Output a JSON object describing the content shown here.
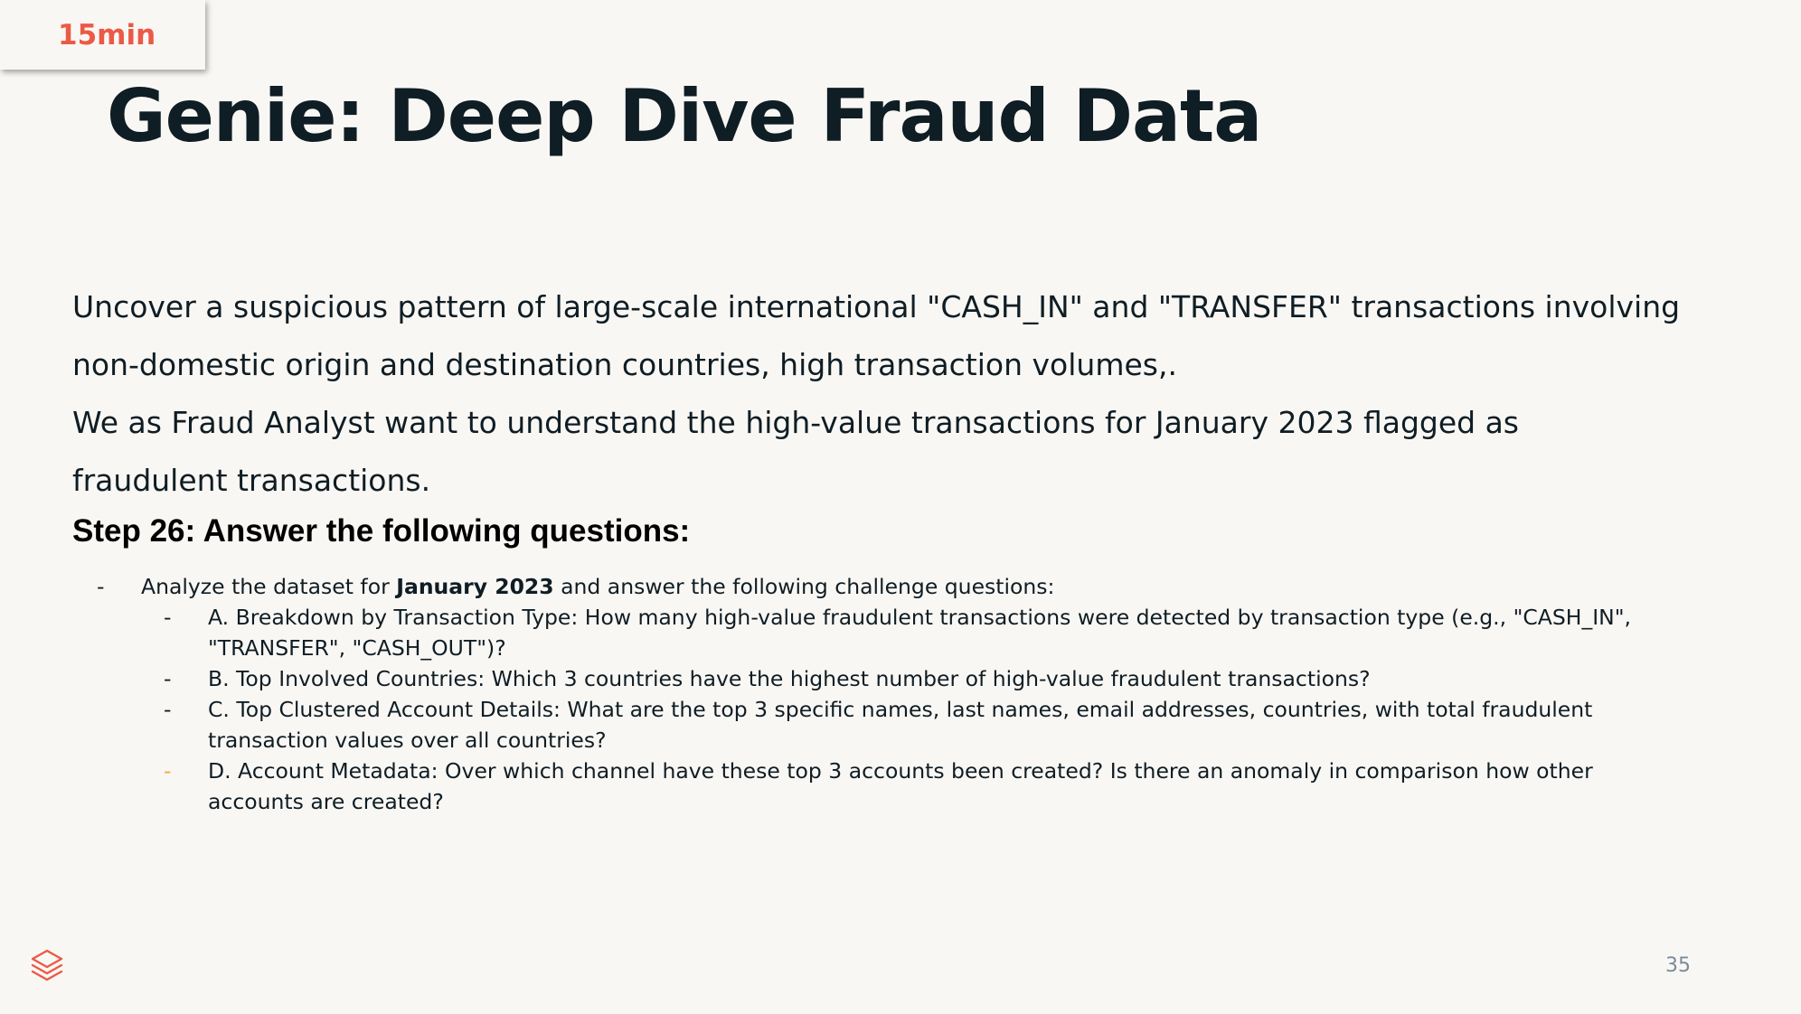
{
  "badge": {
    "label": "15min"
  },
  "slide": {
    "title": "Genie: Deep Dive Fraud Data",
    "intro": [
      "Uncover a suspicious pattern of large-scale international \"CASH_IN\" and \"TRANSFER\" transactions involving non-domestic origin and destination countries, high transaction volumes,.",
      "We as Fraud Analyst want to understand the high-value transactions for January 2023 flagged as fraudulent transactions."
    ],
    "step_heading": "Step 26: Answer the following questions:",
    "main_item": {
      "dash": "-",
      "prefix": "Analyze the dataset for ",
      "bold": "January 2023",
      "suffix": " and answer the following challenge questions:"
    },
    "questions": [
      {
        "dash": "-",
        "text": "A. Breakdown by Transaction Type: How many high-value fraudulent transactions were detected by transaction type (e.g., \"CASH_IN\", \"TRANSFER\", \"CASH_OUT\")?"
      },
      {
        "dash": "-",
        "text": "B. Top Involved Countries: Which 3 countries have the highest number of high-value fraudulent transactions?"
      },
      {
        "dash": "-",
        "text": "C. Top Clustered Account Details: What are the top 3 specific names, last names, email addresses, countries, with total fraudulent transaction values over all countries?"
      },
      {
        "dash": "-",
        "text": "D. Account Metadata: Over which channel have these top 3 accounts been created? Is there an anomaly in comparison how other accounts are created?"
      }
    ],
    "page_number": "35"
  },
  "colors": {
    "background": "#f9f7f4",
    "title": "#0f1d24",
    "badge_text": "#eb5a46",
    "accent_dash": "#f2a93b",
    "logo": "#eb5a46",
    "page_number": "#7a8c99"
  },
  "icons": {
    "logo": "databricks-stack-icon"
  }
}
